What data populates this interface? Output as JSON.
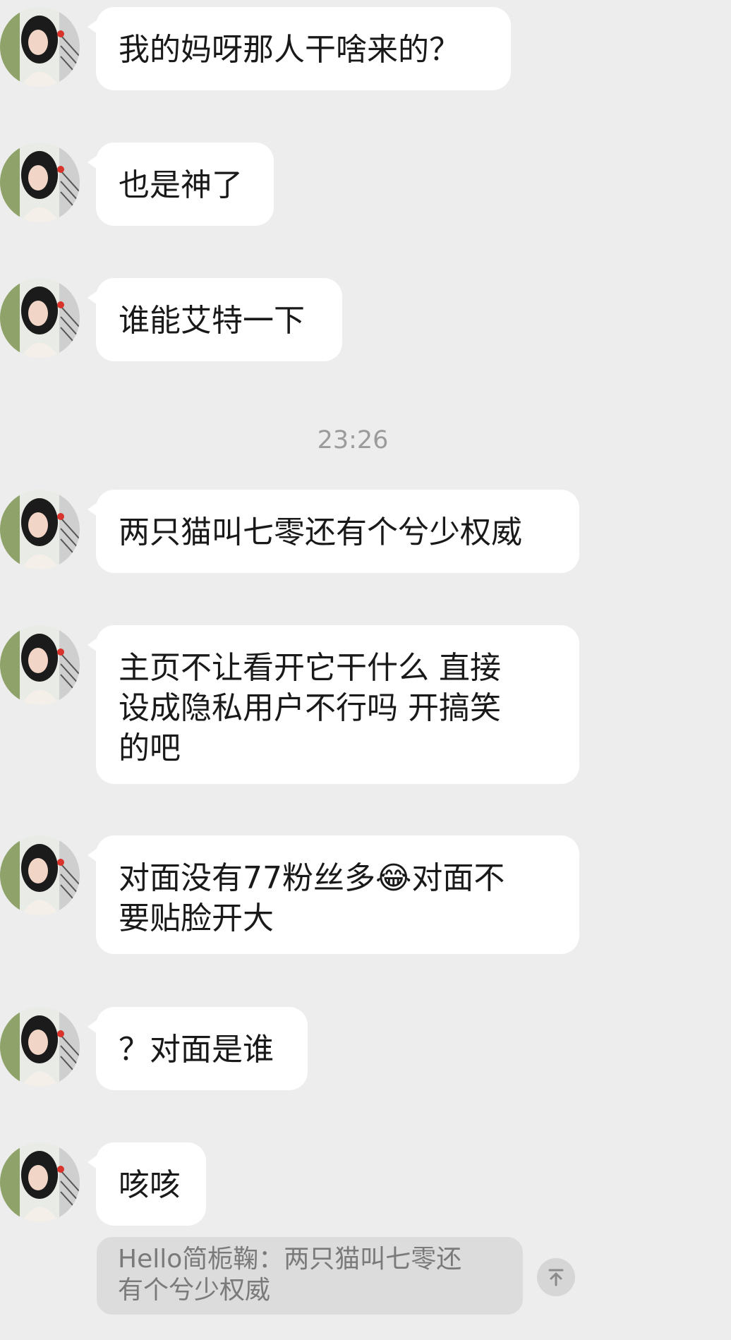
{
  "messages": [
    {
      "text": "我的妈呀那人干啥来的？"
    },
    {
      "text": "也是神了"
    },
    {
      "text": "谁能艾特一下"
    },
    {
      "text": "两只猫叫七零还有个兮少权威"
    },
    {
      "text": "主页不让看开它干什么 直接\n设成隐私用户不行吗 开搞笑\n的吧"
    },
    {
      "text": "对面没有77粉丝多😂对面不\n要贴脸开大"
    },
    {
      "text": "？对面是谁"
    },
    {
      "text": "咳咳"
    }
  ],
  "timestamp": "23:26",
  "quote": {
    "text": "Hello简栀鞠：两只猫叫七零还\n有个兮少权威"
  },
  "icons": {
    "avatar": "avatar-photo",
    "scroll_top": "arrow-up-to-top-icon"
  }
}
